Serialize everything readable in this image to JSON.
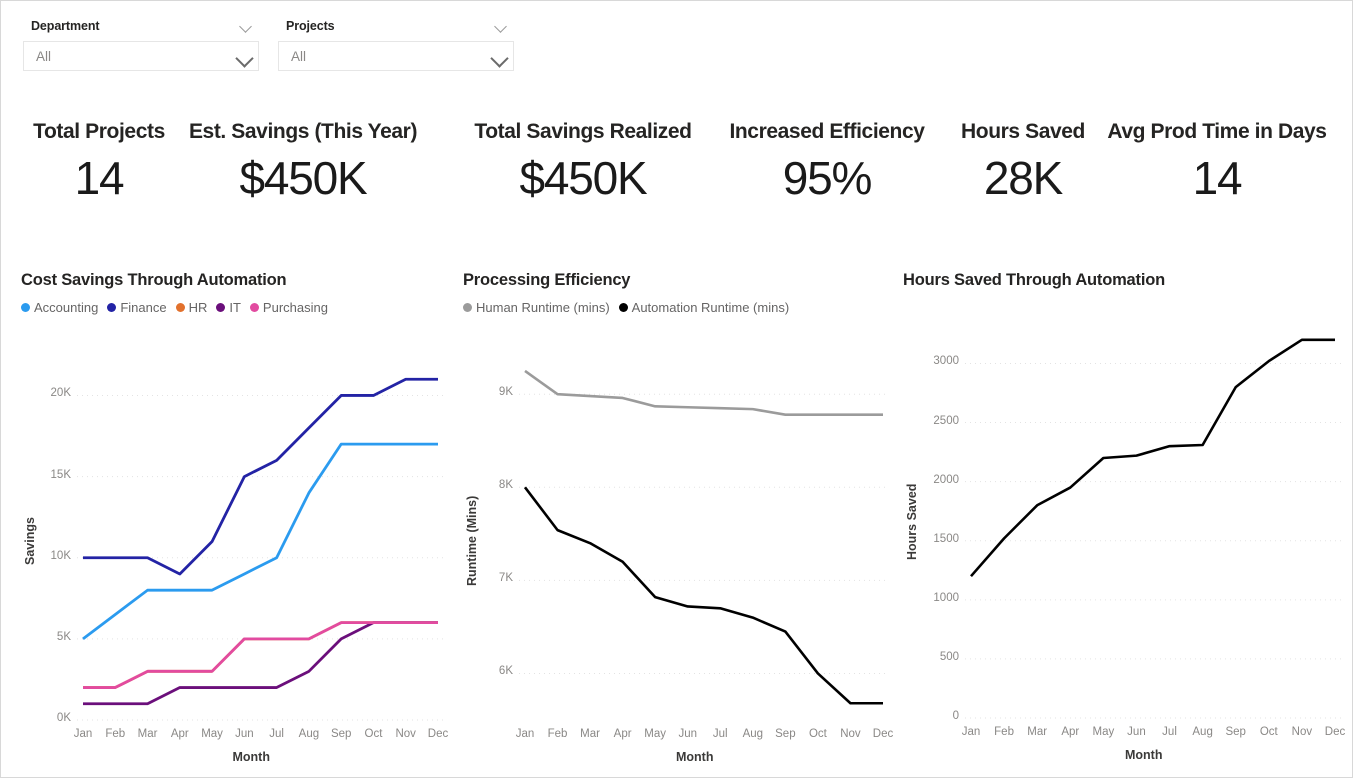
{
  "slicers": [
    {
      "title": "Department",
      "value": "All",
      "chevron_icon": "chevron-down-icon"
    },
    {
      "title": "Projects",
      "value": "All",
      "chevron_icon": "chevron-down-icon"
    }
  ],
  "kpis": [
    {
      "label": "Total Projects",
      "value": "14"
    },
    {
      "label": "Est. Savings (This Year)",
      "value": "$450K"
    },
    {
      "label": "Total Savings Realized",
      "value": "$450K"
    },
    {
      "label": "Increased Efficiency",
      "value": "95%"
    },
    {
      "label": "Hours Saved",
      "value": "28K"
    },
    {
      "label": "Avg Prod Time in Days",
      "value": "14"
    }
  ],
  "colors": {
    "accounting": "#2B9BEF",
    "finance": "#2323A5",
    "hr": "#E2712D",
    "it": "#6B0F7B",
    "purchasing": "#E24BA0",
    "human_runtime": "#9B9B9B",
    "automation_runtime": "#000000",
    "hours_saved": "#000000",
    "text_dark": "#252423",
    "text_muted": "#8a8886",
    "gridline": "#e3e3e3"
  },
  "chart_data": [
    {
      "id": "cost-savings",
      "type": "line",
      "title": "Cost Savings Through Automation",
      "xlabel": "Month",
      "ylabel": "Savings",
      "categories": [
        "Jan",
        "Feb",
        "Mar",
        "Apr",
        "May",
        "Jun",
        "Jul",
        "Aug",
        "Sep",
        "Oct",
        "Nov",
        "Dec"
      ],
      "ylim": [
        0,
        22000
      ],
      "yticks": [
        0,
        5000,
        10000,
        15000,
        20000
      ],
      "ytick_labels": [
        "0K",
        "5K",
        "10K",
        "15K",
        "20K"
      ],
      "grid": true,
      "legend_position": "top",
      "series": [
        {
          "name": "Accounting",
          "color": "#2B9BEF",
          "values": [
            5000,
            6500,
            8000,
            8000,
            8000,
            9000,
            10000,
            14000,
            17000,
            17000,
            17000,
            17000
          ]
        },
        {
          "name": "Finance",
          "color": "#2323A5",
          "values": [
            10000,
            10000,
            10000,
            9000,
            11000,
            15000,
            16000,
            18000,
            20000,
            20000,
            21000,
            21000
          ]
        },
        {
          "name": "HR",
          "color": "#E2712D",
          "values": [
            2000,
            2000,
            3000,
            3000,
            3000,
            5000,
            5000,
            5000,
            6000,
            6000,
            6000,
            6000
          ]
        },
        {
          "name": "IT",
          "color": "#6B0F7B",
          "values": [
            1000,
            1000,
            1000,
            2000,
            2000,
            2000,
            2000,
            3000,
            5000,
            6000,
            6000,
            6000
          ]
        },
        {
          "name": "Purchasing",
          "color": "#E24BA0",
          "values": [
            2000,
            2000,
            3000,
            3000,
            3000,
            5000,
            5000,
            5000,
            6000,
            6000,
            6000,
            6000
          ]
        }
      ]
    },
    {
      "id": "processing-efficiency",
      "type": "line",
      "title": "Processing Efficiency",
      "xlabel": "Month",
      "ylabel": "Runtime (Mins)",
      "categories": [
        "Jan",
        "Feb",
        "Mar",
        "Apr",
        "May",
        "Jun",
        "Jul",
        "Aug",
        "Sep",
        "Oct",
        "Nov",
        "Dec"
      ],
      "ylim": [
        5500,
        9400
      ],
      "yticks": [
        6000,
        7000,
        8000,
        9000
      ],
      "ytick_labels": [
        "6K",
        "7K",
        "8K",
        "9K"
      ],
      "grid": true,
      "legend_position": "top",
      "series": [
        {
          "name": "Human Runtime (mins)",
          "color": "#9B9B9B",
          "values": [
            9250,
            9000,
            8980,
            8960,
            8870,
            8860,
            8850,
            8840,
            8780,
            8780,
            8780,
            8780
          ]
        },
        {
          "name": "Automation Runtime (mins)",
          "color": "#000000",
          "values": [
            8000,
            7540,
            7400,
            7200,
            6820,
            6720,
            6700,
            6600,
            6450,
            6000,
            5680,
            5680
          ]
        }
      ]
    },
    {
      "id": "hours-saved",
      "type": "line",
      "title": "Hours Saved Through Automation",
      "xlabel": "Month",
      "ylabel": "Hours Saved",
      "categories": [
        "Jan",
        "Feb",
        "Mar",
        "Apr",
        "May",
        "Jun",
        "Jul",
        "Aug",
        "Sep",
        "Oct",
        "Nov",
        "Dec"
      ],
      "ylim": [
        0,
        3300
      ],
      "yticks": [
        0,
        500,
        1000,
        1500,
        2000,
        2500,
        3000
      ],
      "ytick_labels": [
        "0",
        "500",
        "1000",
        "1500",
        "2000",
        "2500",
        "3000"
      ],
      "grid": true,
      "legend_position": "none",
      "series": [
        {
          "name": "Hours Saved",
          "color": "#000000",
          "values": [
            1200,
            1520,
            1800,
            1950,
            2200,
            2220,
            2300,
            2310,
            2800,
            3020,
            3200,
            3200
          ]
        }
      ]
    }
  ]
}
